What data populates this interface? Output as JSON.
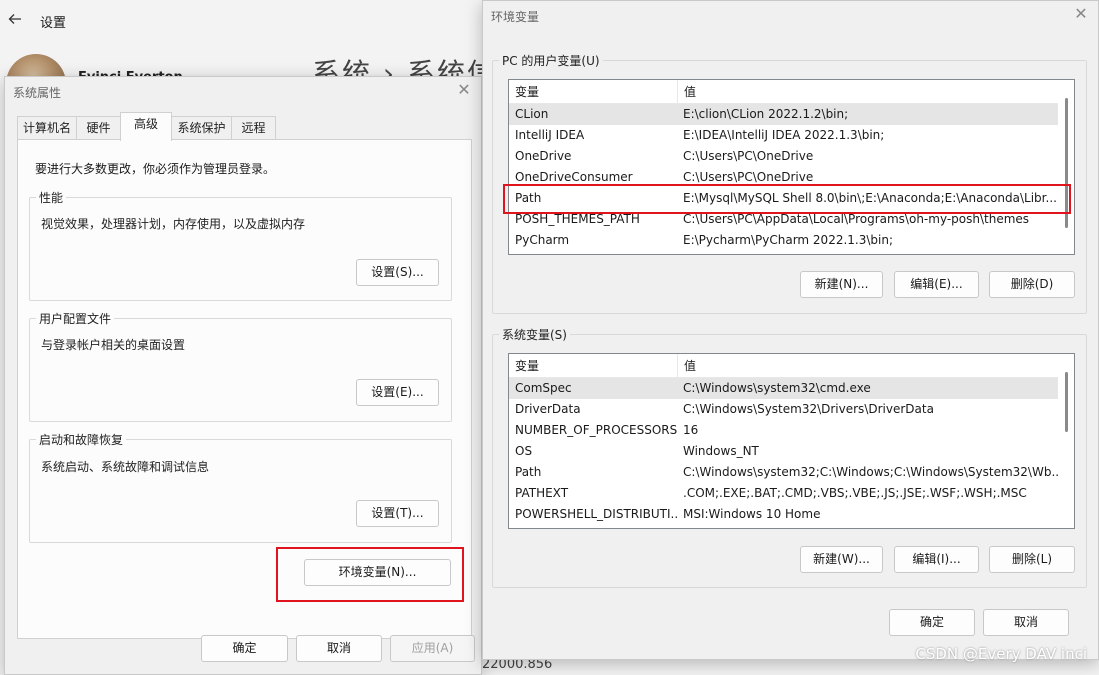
{
  "background": {
    "back_icon": "back-arrow-icon",
    "title": "设置",
    "username": "Evinci Everton",
    "breadcrumb": "系统 › 系统信",
    "version": "22000.856",
    "watermark": "CSDN @Every DAV inci"
  },
  "sysprops": {
    "title": "系统属性",
    "tabs": [
      "计算机名",
      "硬件",
      "高级",
      "系统保护",
      "远程"
    ],
    "active_tab": "高级",
    "admin_note": "要进行大多数更改，你必须作为管理员登录。",
    "performance": {
      "legend": "性能",
      "desc": "视觉效果，处理器计划，内存使用，以及虚拟内存",
      "button": "设置(S)..."
    },
    "profiles": {
      "legend": "用户配置文件",
      "desc": "与登录帐户相关的桌面设置",
      "button": "设置(E)..."
    },
    "startup": {
      "legend": "启动和故障恢复",
      "desc": "系统启动、系统故障和调试信息",
      "button": "设置(T)..."
    },
    "env_button": "环境变量(N)...",
    "ok": "确定",
    "cancel": "取消",
    "apply": "应用(A)"
  },
  "envvars": {
    "title": "环境变量",
    "user": {
      "legend": "PC 的用户变量(U)",
      "columns": [
        "变量",
        "值"
      ],
      "rows": [
        [
          "CLion",
          "E:\\clion\\CLion 2022.1.2\\bin;"
        ],
        [
          "IntelliJ IDEA",
          "E:\\IDEA\\IntelliJ IDEA 2022.1.3\\bin;"
        ],
        [
          "OneDrive",
          "C:\\Users\\PC\\OneDrive"
        ],
        [
          "OneDriveConsumer",
          "C:\\Users\\PC\\OneDrive"
        ],
        [
          "Path",
          "E:\\Mysql\\MySQL Shell 8.0\\bin\\;E:\\Anaconda;E:\\Anaconda\\Libr..."
        ],
        [
          "POSH_THEMES_PATH",
          "C:\\Users\\PC\\AppData\\Local\\Programs\\oh-my-posh\\themes"
        ],
        [
          "PyCharm",
          "E:\\Pycharm\\PyCharm 2022.1.3\\bin;"
        ]
      ],
      "new": "新建(N)...",
      "edit": "编辑(E)...",
      "delete": "删除(D)"
    },
    "system": {
      "legend": "系统变量(S)",
      "columns": [
        "变量",
        "值"
      ],
      "rows": [
        [
          "ComSpec",
          "C:\\Windows\\system32\\cmd.exe"
        ],
        [
          "DriverData",
          "C:\\Windows\\System32\\Drivers\\DriverData"
        ],
        [
          "NUMBER_OF_PROCESSORS",
          "16"
        ],
        [
          "OS",
          "Windows_NT"
        ],
        [
          "Path",
          "C:\\Windows\\system32;C:\\Windows;C:\\Windows\\System32\\Wb..."
        ],
        [
          "PATHEXT",
          ".COM;.EXE;.BAT;.CMD;.VBS;.VBE;.JS;.JSE;.WSF;.WSH;.MSC"
        ],
        [
          "POWERSHELL_DISTRIBUTI...",
          "MSI:Windows 10 Home"
        ]
      ],
      "new": "新建(W)...",
      "edit": "编辑(I)...",
      "delete": "删除(L)"
    },
    "ok": "确定",
    "cancel": "取消"
  }
}
